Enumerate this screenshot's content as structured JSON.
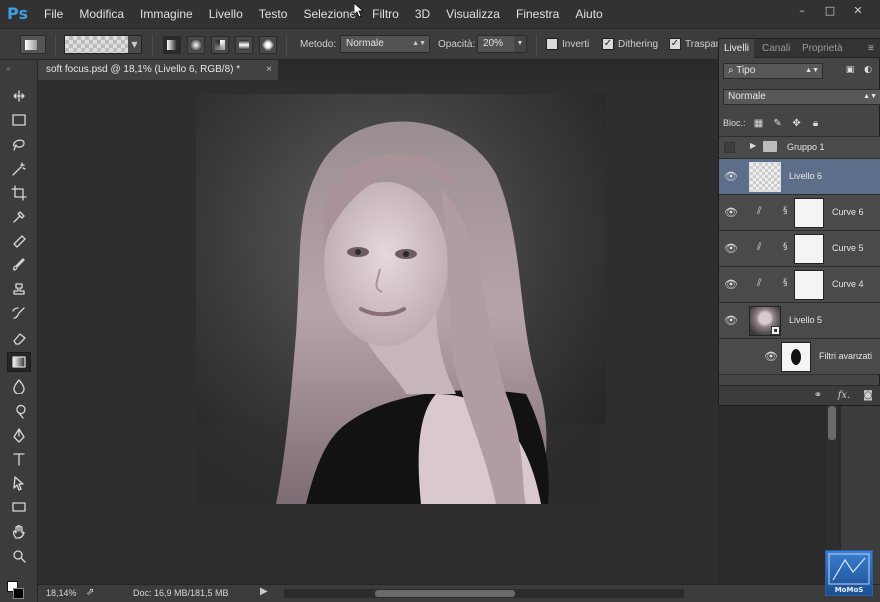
{
  "app": {
    "logo": "Ps"
  },
  "menu": [
    "File",
    "Modifica",
    "Immagine",
    "Livello",
    "Testo",
    "Selezione",
    "Filtro",
    "3D",
    "Visualizza",
    "Finestra",
    "Aiuto"
  ],
  "window_controls": {
    "minimize": "–",
    "maximize": "□",
    "close": "✕"
  },
  "options": {
    "metodo_label": "Metodo:",
    "metodo_value": "Normale",
    "opacita_label": "Opacità:",
    "opacita_value": "20%",
    "inverti_label": "Inverti",
    "inverti_checked": false,
    "dithering_label": "Dithering",
    "dithering_checked": true,
    "trasparenza_label": "Traspar",
    "trasparenza_checked": true
  },
  "document": {
    "tab_title": "soft focus.psd @ 18,1% (Livello 6, RGB/8) *",
    "close": "×"
  },
  "status": {
    "zoom": "18,14%",
    "doc_size": "Doc: 16,9 MB/181,5 MB",
    "scroll_fraction": 0.35
  },
  "layers_panel": {
    "tabs": [
      "Livelli",
      "Canali",
      "Proprietà"
    ],
    "active_tab": "Livelli",
    "filter_label": "Tipo",
    "blend_mode": "Normale",
    "lock_label": "Bloc.:",
    "layers": [
      {
        "name": "Gruppo 1",
        "kind": "group",
        "visible": false,
        "selected": false
      },
      {
        "name": "Livello 6",
        "kind": "pixel-empty",
        "visible": true,
        "selected": true
      },
      {
        "name": "Curve 6",
        "kind": "adjustment",
        "visible": true,
        "selected": false
      },
      {
        "name": "Curve 5",
        "kind": "adjustment",
        "visible": true,
        "selected": false
      },
      {
        "name": "Curve 4",
        "kind": "adjustment",
        "visible": true,
        "selected": false
      },
      {
        "name": "Livello 5",
        "kind": "smart-object",
        "visible": true,
        "selected": false
      },
      {
        "name": "Filtri avanzati",
        "kind": "smart-filter",
        "visible": true,
        "selected": false
      }
    ],
    "footer_fx": "fx."
  },
  "tools": [
    "move-tool",
    "marquee-tool",
    "lasso-tool",
    "magic-wand-tool",
    "crop-tool",
    "eyedropper-tool",
    "healing-brush-tool",
    "brush-tool",
    "clone-stamp-tool",
    "history-brush-tool",
    "eraser-tool",
    "gradient-tool",
    "blur-tool",
    "dodge-tool",
    "pen-tool",
    "type-tool",
    "path-selection-tool",
    "shape-tool",
    "hand-tool",
    "zoom-tool"
  ],
  "active_tool": "gradient-tool",
  "watermark": {
    "text": "MoMoS"
  },
  "colors": {
    "selected_layer": "#5c6e8a",
    "ps_logo": "#3f9edf",
    "panel": "#454545"
  }
}
